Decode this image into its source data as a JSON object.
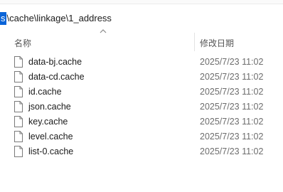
{
  "toolbar": {
    "stub_labels": [
      "",
      "",
      ""
    ]
  },
  "address": {
    "selected_char": "s",
    "path_rest": "\\cache\\linkage\\1_address"
  },
  "columns": {
    "name": "名称",
    "modified": "修改日期",
    "sort": "ascending"
  },
  "files": [
    {
      "name": "data-bj.cache",
      "modified": "2025/7/23 11:02"
    },
    {
      "name": "data-cd.cache",
      "modified": "2025/7/23 11:02"
    },
    {
      "name": "id.cache",
      "modified": "2025/7/23 11:02"
    },
    {
      "name": "json.cache",
      "modified": "2025/7/23 11:02"
    },
    {
      "name": "key.cache",
      "modified": "2025/7/23 11:02"
    },
    {
      "name": "level.cache",
      "modified": "2025/7/23 11:02"
    },
    {
      "name": "list-0.cache",
      "modified": "2025/7/23 11:02"
    }
  ],
  "colors": {
    "selection": "#0a64d8",
    "date_text": "#6d6d6d",
    "header_text": "#555555"
  },
  "icons": {
    "file": "document-icon",
    "sort": "sort-up-chevron-icon"
  }
}
